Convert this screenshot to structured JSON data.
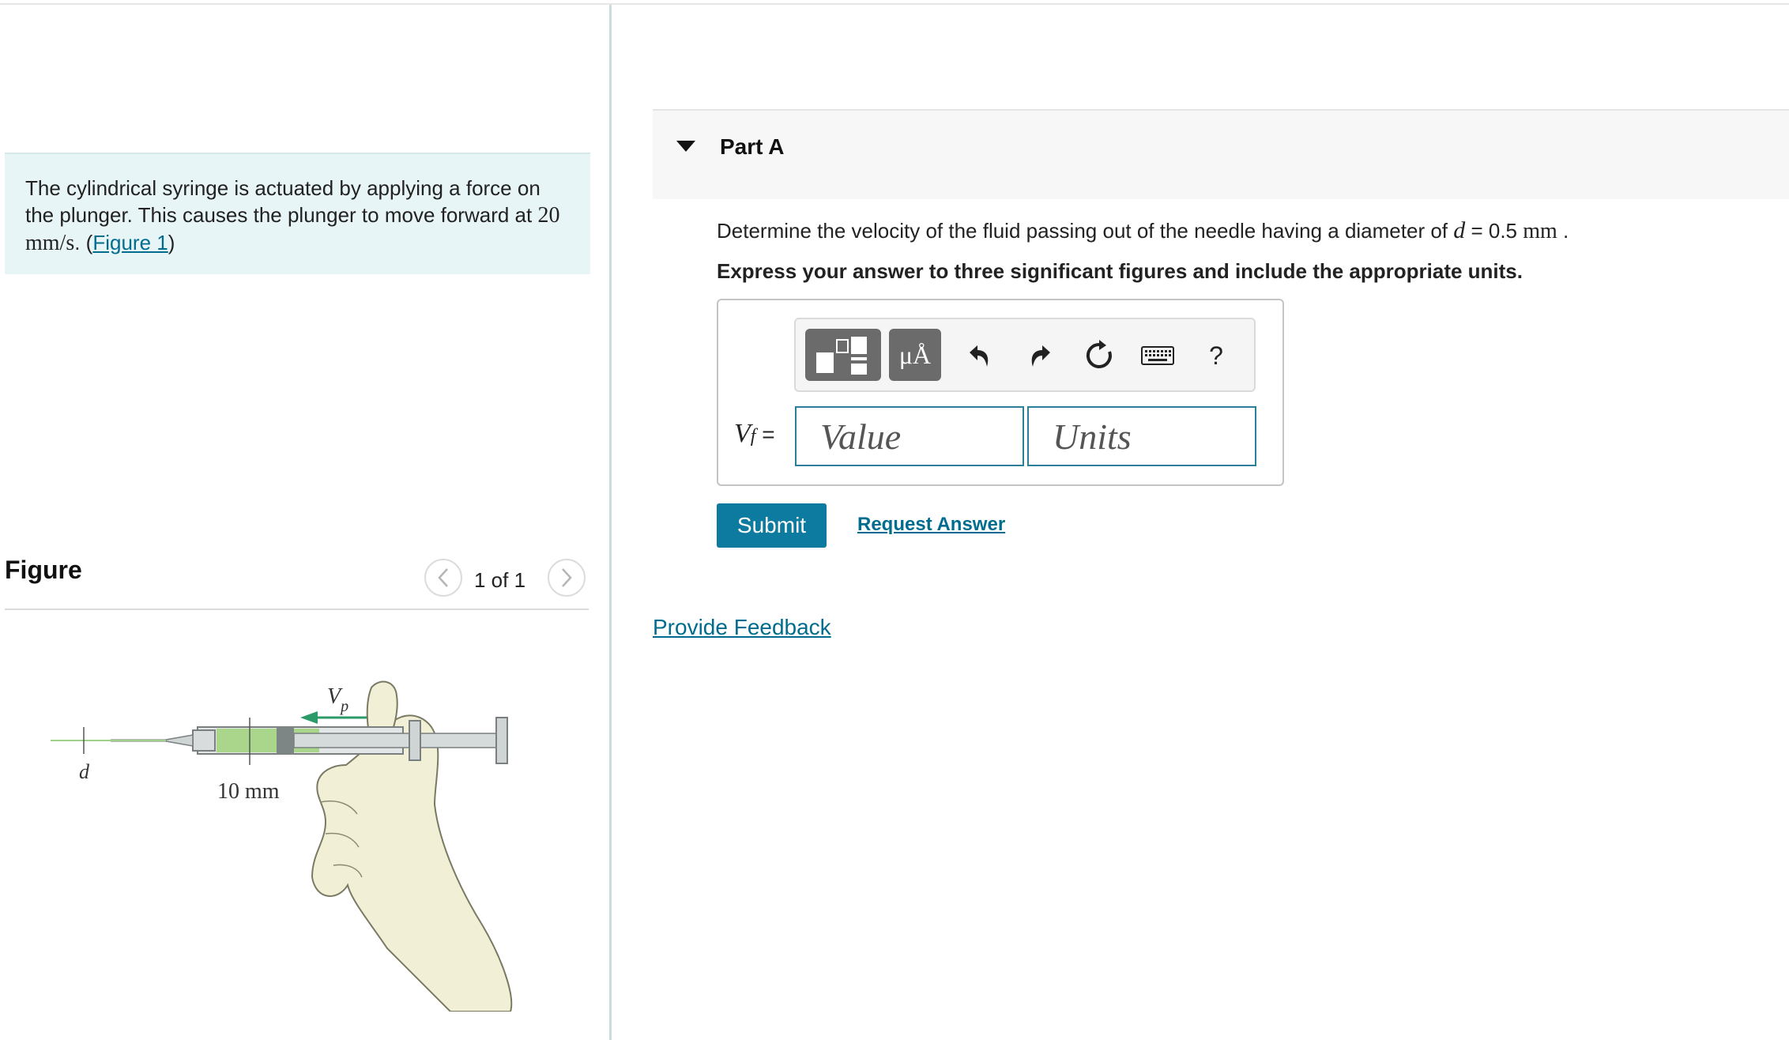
{
  "problem": {
    "text_before": "The cylindrical syringe is actuated by applying a force on the plunger. This causes the plunger to move forward at ",
    "speed": "20 mm/s",
    "text_mid": ". (",
    "figure_link": "Figure 1",
    "text_after": ")"
  },
  "figure": {
    "title": "Figure",
    "counter": "1 of 1",
    "prev_icon": "chevron-left-icon",
    "next_icon": "chevron-right-icon",
    "labels": {
      "velocity": "V",
      "velocity_sub": "p",
      "diameter": "d",
      "barrel": "10 mm"
    }
  },
  "part": {
    "caret_icon": "caret-down-icon",
    "title": "Part A",
    "question_before": "Determine the velocity of the fluid passing out of the needle having a diameter of ",
    "question_var": "d",
    "question_eq": " = 0.5 ",
    "question_unit": "mm",
    "question_after": " .",
    "instruction": "Express your answer to three significant figures and include the appropriate units."
  },
  "toolbar": {
    "units_label": "μÅ",
    "help_label": "?",
    "icons": [
      "templates-icon",
      "units-icon",
      "undo-icon",
      "redo-icon",
      "reset-icon",
      "keyboard-icon",
      "help-icon"
    ]
  },
  "answer": {
    "var": "V",
    "var_sub": "f",
    "equals": " =",
    "value_placeholder": "Value",
    "units_placeholder": "Units"
  },
  "actions": {
    "submit": "Submit",
    "request_answer": "Request Answer",
    "feedback": "Provide Feedback"
  },
  "colors": {
    "accent": "#0d7aa0",
    "link": "#006d8f",
    "problem_bg": "#e8f5f7",
    "header_bg": "#f7f7f7",
    "fluid": "#a9d68a",
    "glove": "#f1efd6"
  }
}
